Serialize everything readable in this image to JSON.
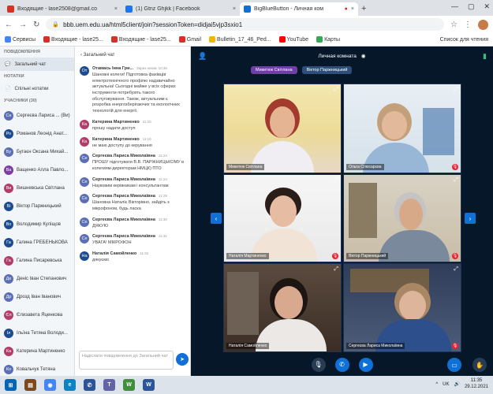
{
  "tabs": [
    {
      "label": "Входящие - lase2508@gmail.co",
      "x": "×",
      "color": "#d93025"
    },
    {
      "label": "(1) Gtnz Ghjkk | Facebook",
      "x": "×",
      "color": "#1877f2"
    },
    {
      "label": "BigBlueButton - Личная ком",
      "x": "×",
      "color": "#0f70d7"
    }
  ],
  "url": "bbb.uem.edu.ua/html5client/join?sessionToken=didjai5vjp3sxio1",
  "bookmarks": [
    "Сервисы",
    "Входящие - lase25...",
    "Входящие - lase25...",
    "Gmail",
    "Bulletin_17_46_Ped...",
    "YouTube",
    "Карты"
  ],
  "bookmarks_right": "Список для чтения",
  "sidebar": {
    "messages_section": "ПОВІДОМЛЕННЯ",
    "public_chat": "Загальний чат",
    "notes_section": "НОТАТКИ",
    "shared_notes": "Спільні нотатки",
    "users_section": "УЧАСНИКИ (30)",
    "users": [
      {
        "initials": "Се",
        "name": "Сергеєва Лариса ... (Ви)",
        "color": "#5a6fb4"
      },
      {
        "initials": "Ро",
        "name": "Романов Леонід Анат...",
        "color": "#1c4c8f"
      },
      {
        "initials": "Бу",
        "name": "Бугаєн Оксана Михай...",
        "color": "#5a6fb4"
      },
      {
        "initials": "Ва",
        "name": "Ващенко Алла Павло...",
        "color": "#7a3fa0"
      },
      {
        "initials": "Ви",
        "name": "Вишневська Світлана",
        "color": "#b23d6a"
      },
      {
        "initials": "Ві",
        "name": "Віктор Паржницький",
        "color": "#1c4c8f"
      },
      {
        "initials": "Во",
        "name": "Володимир Куліщов",
        "color": "#1c4c8f"
      },
      {
        "initials": "Га",
        "name": "Галина ГРЕБЕНЬКОВА",
        "color": "#1c4c8f"
      },
      {
        "initials": "Га",
        "name": "Галина Писаревська",
        "color": "#b23d6a"
      },
      {
        "initials": "Де",
        "name": "Деніс Іван Степанович",
        "color": "#5a6fb4"
      },
      {
        "initials": "Др",
        "name": "Дрозд Іван Іванович",
        "color": "#5a6fb4"
      },
      {
        "initials": "Єл",
        "name": "Єлизавета Яценкова",
        "color": "#b23d6a"
      },
      {
        "initials": "Іл",
        "name": "Ільїна Тетяна Володи...",
        "color": "#1c4c8f"
      },
      {
        "initials": "Ка",
        "name": "Катерина Мартиненко",
        "color": "#b23d6a"
      },
      {
        "initials": "Ко",
        "name": "Ковальчук Тетяна",
        "color": "#5a6fb4"
      }
    ]
  },
  "chat": {
    "header": "Загальний чат",
    "messages": [
      {
        "initials": "От",
        "name": "Отамась Інна Гри...",
        "time": "Зараз немає 10:36",
        "text": "Шановні колеги! Підготовка фахівців електротехнічного профілю надзвичайно актуальна! Сьогодні майже у всіх сферах інструменти потребують такого обслуговування. Також, актуальним є розробка енергозберігаючих та екологічних технологій для енергії.",
        "color": "#1c4c8f"
      },
      {
        "initials": "Ка",
        "name": "Катерина Мартиненко",
        "time": "11:10",
        "text": "прошу надати доступ",
        "color": "#b23d6a"
      },
      {
        "initials": "Ка",
        "name": "Катерина Мартиненко",
        "time": "11:10",
        "text": "не маю доступу до керування",
        "color": "#b23d6a"
      },
      {
        "initials": "Се",
        "name": "Сергеєва Лариса Миколаївна",
        "time": "11:24",
        "text": "ПРОШУ підготувати В.В. ПАРЖНИЦЬКОМУ в колегиям-директорам НМЦК) ПТО",
        "color": "#5a6fb4"
      },
      {
        "initials": "Се",
        "name": "Сергеєва Лариса Миколаївна",
        "time": "11:24",
        "text": "Науковим керівникам і консультантам",
        "color": "#5a6fb4"
      },
      {
        "initials": "Се",
        "name": "Сергеєва Лариса Миколаївна",
        "time": "11:29",
        "text": "Шановна Наталіє Вікторівно, зайдіть з мікрофоном, будь ласка",
        "color": "#5a6fb4"
      },
      {
        "initials": "Се",
        "name": "Сергеєва Лариса Миколаївна",
        "time": "11:30",
        "text": "ДЯКУЮ",
        "color": "#5a6fb4"
      },
      {
        "initials": "Се",
        "name": "Сергеєва Лариса Миколаївна",
        "time": "11:31",
        "text": "УВАГА! МІКРОФОН",
        "color": "#5a6fb4"
      },
      {
        "initials": "На",
        "name": "Наталія Самойленко",
        "time": "11:32",
        "text": "дякуємо",
        "color": "#1c4c8f"
      }
    ],
    "input_placeholder": "Надіслати повідомлення до Загальний чат"
  },
  "room": {
    "title": "Личная комната",
    "speakers": [
      "Микитюк Світлана",
      "Віктор Паржницький"
    ],
    "tiles": [
      {
        "name": "Микитюк Світлана"
      },
      {
        "name": "Ольга Слюсарєва"
      },
      {
        "name": "Наталія Мартиненко"
      },
      {
        "name": "Віктор Паржницький"
      },
      {
        "name": "Наталія Самойленко"
      },
      {
        "name": "Сергеєва Лариса Миколаївна"
      }
    ]
  },
  "taskbar": {
    "lang": "UK",
    "time": "11:35",
    "date": "29.12.2021"
  }
}
